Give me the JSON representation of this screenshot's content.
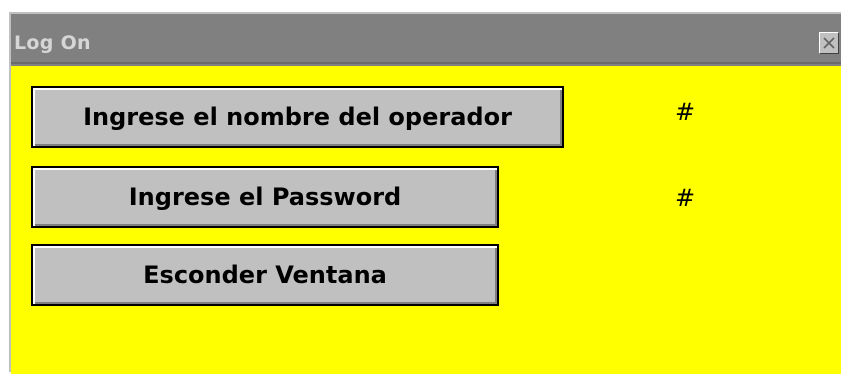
{
  "window": {
    "title": "Log On",
    "close_icon": "close-icon",
    "background_color": "#ffff00",
    "titlebar_color": "#808080"
  },
  "form": {
    "operator_button_label": "Ingrese el nombre del operador",
    "operator_value": "#",
    "password_button_label": "Ingrese el Password",
    "password_value": "#",
    "hide_button_label": "Esconder Ventana"
  }
}
